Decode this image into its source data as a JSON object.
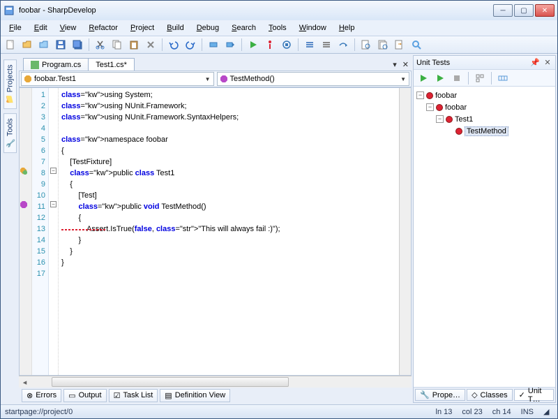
{
  "window": {
    "title": "foobar - SharpDevelop"
  },
  "menu": [
    "File",
    "Edit",
    "View",
    "Refactor",
    "Project",
    "Build",
    "Debug",
    "Search",
    "Tools",
    "Window",
    "Help"
  ],
  "left_tabs": [
    "Projects",
    "Tools"
  ],
  "tabs": [
    {
      "label": "Program.cs",
      "active": false
    },
    {
      "label": "Test1.cs*",
      "active": true
    }
  ],
  "nav": {
    "class": "foobar.Test1",
    "method": "TestMethod()"
  },
  "code": {
    "lines": [
      "using System;",
      "using NUnit.Framework;",
      "using NUnit.Framework.SyntaxHelpers;",
      "",
      "namespace foobar",
      "{",
      "    [TestFixture]",
      "    public class Test1",
      "    {",
      "        [Test]",
      "        public void TestMethod()",
      "        {",
      "            Assert.IsTrue(false, \"This will always fail :)\");",
      "        }",
      "    }",
      "}",
      ""
    ],
    "line_count": 17
  },
  "bottom_tabs": [
    "Errors",
    "Output",
    "Task List",
    "Definition View"
  ],
  "unit_tests": {
    "title": "Unit Tests",
    "tree": [
      {
        "level": 0,
        "label": "foobar",
        "expand": "-"
      },
      {
        "level": 1,
        "label": "foobar",
        "expand": "-"
      },
      {
        "level": 2,
        "label": "Test1",
        "expand": "-"
      },
      {
        "level": 3,
        "label": "TestMethod",
        "selected": true
      }
    ]
  },
  "right_tabs": [
    "Prope…",
    "Classes",
    "Unit T…"
  ],
  "status": {
    "left": "startpage://project/0",
    "ln": "ln 13",
    "col": "col 23",
    "ch": "ch 14",
    "ins": "INS"
  }
}
